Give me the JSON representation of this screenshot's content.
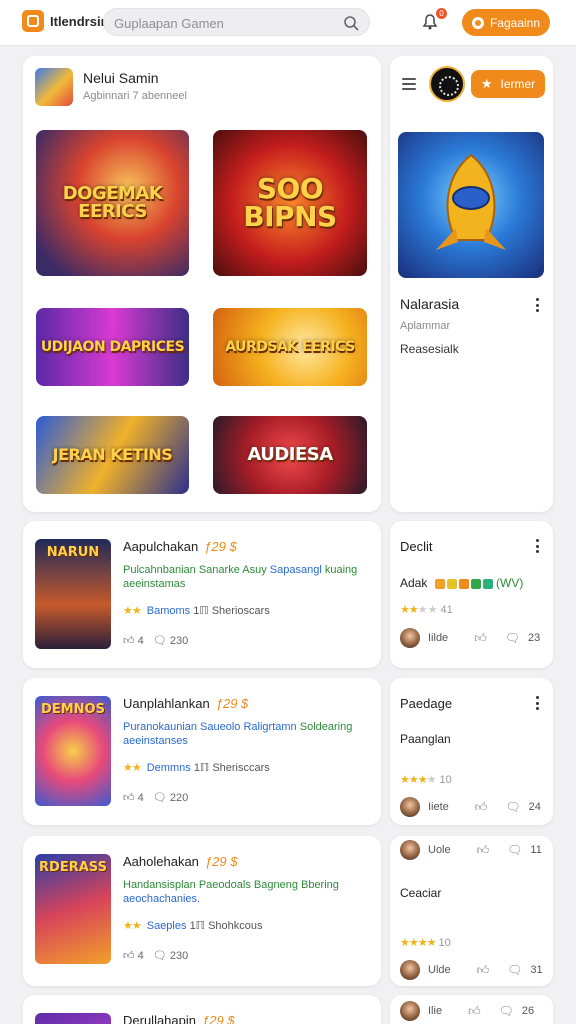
{
  "header": {
    "brand": "Itlendrsin",
    "search_placeholder": "Guplaapan Gamen",
    "notification_count": "0",
    "signup_label": "Fagaainn"
  },
  "featured": {
    "title": "Nelui Samin",
    "subtitle": "Agbinnari 7 abenneel",
    "tiles": [
      {
        "text": "DOGEMAK EERICS"
      },
      {
        "text": "SOO BIPNS"
      },
      {
        "text": "UDIJAON DAPRICES"
      },
      {
        "text": "AURDSAK EERICS"
      },
      {
        "text": "JERAN KETINS"
      },
      {
        "text": "AUDIESA"
      }
    ]
  },
  "profile": {
    "follow_label": "Iermer",
    "title": "Nalarasia",
    "subtitle": "Aplammar",
    "link": "Reasesialk"
  },
  "listings": [
    {
      "title": "Aapulchakan",
      "price": "ƒ29 $",
      "thumb_text": "NARUN",
      "desc_green": "Pulcahnbanian Sanarke Asuy",
      "desc_blue": "Sapasangl",
      "desc_green2": "kuaing",
      "desc_line2": "aeeinstamas",
      "rating_stars": "★★",
      "location": "Bamoms",
      "players": "1ℿ Sherioscars",
      "likes": "4",
      "comments": "230"
    },
    {
      "title": "Uanplahlankan",
      "price": "ƒ29 $",
      "thumb_text": "DEMNOS",
      "desc_green": "",
      "desc_blue": "Puranokaunian Saueolo Raligrtamn",
      "desc_green2": "Soldearing",
      "desc_line2": "aeeinstanses",
      "rating_stars": "★★",
      "location": "Demmns",
      "players": "1ℿ Sherisccars",
      "likes": "4",
      "comments": "220"
    },
    {
      "title": "Aaholehakan",
      "price": "ƒ29 $",
      "thumb_text": "RDERASS",
      "desc_green": "Handansisplan Paeodoals",
      "desc_blue": "",
      "desc_green2": "Bagneng  Bbering",
      "desc_line2": "aeochachanies.",
      "rating_stars": "★★",
      "location": "Saeples",
      "players": "1ℿ Shohkcous",
      "likes": "4",
      "comments": "230"
    },
    {
      "title": "Derullahapin",
      "price": "ƒ29 $"
    }
  ],
  "side_cards": [
    {
      "title": "Declit",
      "line": "Adak",
      "badge_text": "(WV)",
      "rating_count": "41",
      "rating_stars": "★★",
      "rating_empty": "★★",
      "user": "Iilde",
      "likes": "",
      "comments": "23"
    },
    {
      "title": "Paedage",
      "line": "Paanglan",
      "rating_count": "10",
      "rating_stars": "★★★",
      "rating_empty": "★",
      "user": "Iiete",
      "likes": "",
      "comments": "24"
    },
    {
      "user_top": "Uole",
      "comments_top": "11",
      "line": "Ceaciar",
      "rating_count": "10",
      "rating_stars": "★★★★",
      "user": "Ulde",
      "comments": "31"
    },
    {
      "user": "Ilie",
      "comments": "26"
    }
  ],
  "colors": {
    "accent": "#f08a1a",
    "price": "#f08a1a",
    "desc_green": "#2f8a3a",
    "desc_blue": "#2a6ad0",
    "star": "#f2b21a"
  }
}
